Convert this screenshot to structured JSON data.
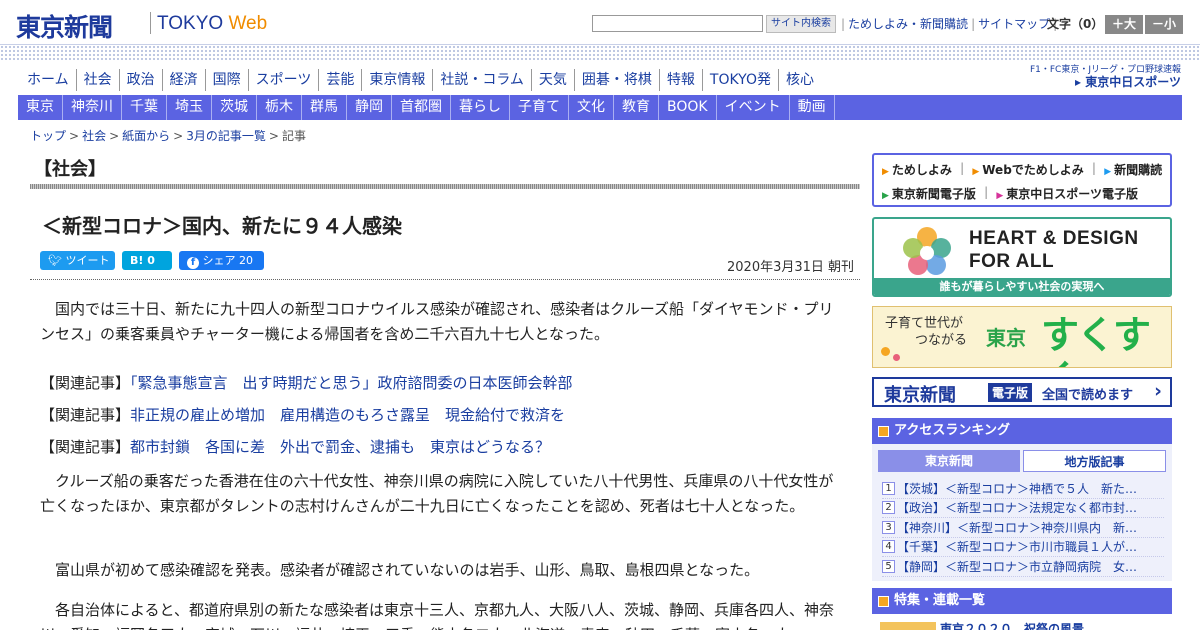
{
  "header": {
    "logo_jp": "東京新聞",
    "logo_en_main": "TOKYO",
    "logo_en_web": "Web",
    "search_button": "サイト内検索",
    "links": [
      "ためしよみ・新聞購読",
      "サイトマップ"
    ],
    "font_label": "文字（0）",
    "font_larger": "＋大",
    "font_smaller": "－小"
  },
  "nav_primary": [
    "ホーム",
    "社会",
    "政治",
    "経済",
    "国際",
    "スポーツ",
    "芸能",
    "東京情報",
    "社説・コラム",
    "天気",
    "囲碁・将棋",
    "特報",
    "TOKYO発",
    "核心"
  ],
  "chunichi": {
    "tagline": "F1・FC東京・Jリーグ・プロ野球速報",
    "brand": "東京中日スポーツ"
  },
  "nav_regional": [
    "東京",
    "神奈川",
    "千葉",
    "埼玉",
    "茨城",
    "栃木",
    "群馬",
    "静岡",
    "首都圏",
    "暮らし",
    "子育て",
    "文化",
    "教育",
    "BOOK",
    "イベント",
    "動画"
  ],
  "breadcrumb": {
    "items": [
      "トップ",
      "社会",
      "紙面から",
      "3月の記事一覧",
      "記事"
    ],
    "separator": ">"
  },
  "article": {
    "section": "【社会】",
    "headline": "＜新型コロナ＞国内、新たに９４人感染",
    "share": {
      "tweet": "ツイート",
      "hatena": "B! 0",
      "facebook": "シェア 20"
    },
    "date": "2020年3月31日 朝刊",
    "p1": "国内では三十日、新たに九十四人の新型コロナウイルス感染が確認され、感染者はクルーズ船「ダイヤモンド・プリンセス」の乗客乗員やチャーター機による帰国者を含め二千六百九十七人となった。",
    "related_label": "【関連記事】",
    "related": [
      "「緊急事態宣言　出す時期だと思う」政府諮問委の日本医師会幹部",
      "非正規の雇止め増加　雇用構造のもろさ露呈　現金給付で救済を",
      "都市封鎖　各国に差　外出で罰金、逮捕も　東京はどうなる？"
    ],
    "p2": "クルーズ船の乗客だった香港在住の六十代女性、神奈川県の病院に入院していた八十代男性、兵庫県の八十代女性が亡くなったほか、東京都がタレントの志村けんさんが二十九日に亡くなったことを認め、死者は七十人となった。",
    "p3": "富山県が初めて感染確認を発表。感染者が確認されていないのは岩手、山形、鳥取、島根四県となった。",
    "p4": "各自治体によると、都道府県別の新たな感染者は東京十三人、京都九人、大阪八人、茨城、静岡、兵庫各四人、神奈川、愛知、福岡各三人、宮城、石川、福井、埼玉、三重、熊本各二人、北海道、青森、秋田、千葉、富山各一人。"
  },
  "sidebar": {
    "links_row1": [
      "ためしよみ",
      "Webでためしよみ",
      "新聞購読"
    ],
    "links_row2": [
      "東京新聞電子版",
      "東京中日スポーツ電子版"
    ],
    "link_colors": [
      "#f08c00",
      "#f08c00",
      "#1d9bf0",
      "#2aa34a",
      "#d6339a"
    ],
    "banner_hd": {
      "title_line1": "HEART & DESIGN",
      "title_line2": "FOR ALL",
      "footer": "誰もが暮らしやすい社会の実現へ"
    },
    "banner_suku": {
      "line1": "子育て世代が",
      "line2": "つながる",
      "city": "東京",
      "big": "すくすく"
    },
    "banner_epaper": {
      "title": "東京新聞",
      "badge": "電子版",
      "message": "全国で読めます"
    },
    "ranking": {
      "title": "アクセスランキング",
      "tab_active": "東京新聞",
      "tab_other": "地方版記事",
      "items": [
        {
          "n": "1",
          "text": "【茨城】＜新型コロナ＞神栖で５人　新た…"
        },
        {
          "n": "2",
          "text": "【政治】＜新型コロナ＞法規定なく都市封…"
        },
        {
          "n": "3",
          "text": "【神奈川】＜新型コロナ＞神奈川県内　新…"
        },
        {
          "n": "4",
          "text": "【千葉】＜新型コロナ＞市川市職員１人が…"
        },
        {
          "n": "5",
          "text": "【静岡】＜新型コロナ＞市立静岡病院　女…"
        }
      ]
    },
    "features": {
      "title": "特集・連載一覧",
      "item": "東京２０２０　祝祭の風景"
    }
  }
}
